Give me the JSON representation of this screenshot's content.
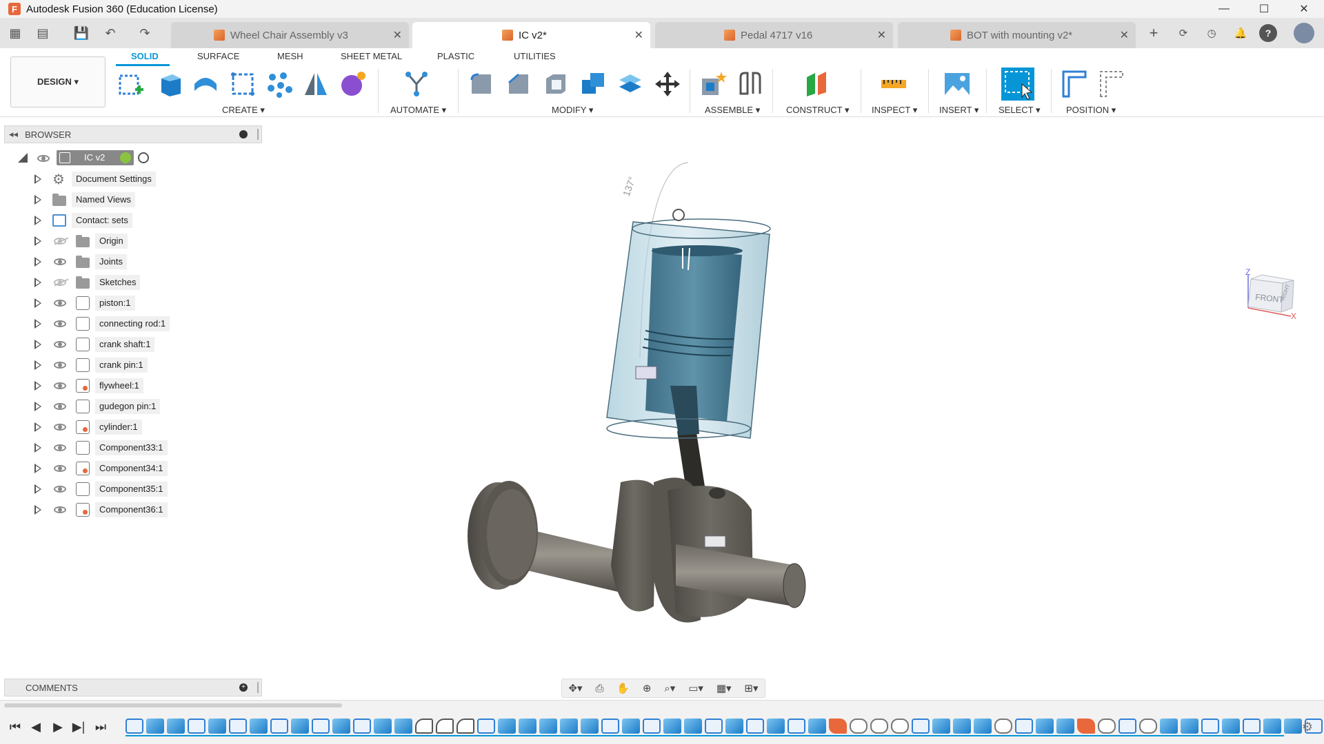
{
  "window": {
    "title": "Autodesk Fusion 360 (Education License)",
    "logo": "F"
  },
  "tabs": [
    {
      "label": "Wheel Chair Assembly v3",
      "active": false
    },
    {
      "label": "IC v2*",
      "active": true
    },
    {
      "label": "Pedal 4717 v16",
      "active": false
    },
    {
      "label": "BOT with mounting v2*",
      "active": false
    }
  ],
  "toolbar": {
    "workspace": "DESIGN ▾",
    "tabs": [
      "SOLID",
      "SURFACE",
      "MESH",
      "SHEET METAL",
      "PLASTIC",
      "UTILITIES"
    ],
    "groups": [
      "CREATE ▾",
      "AUTOMATE ▾",
      "MODIFY ▾",
      "ASSEMBLE ▾",
      "CONSTRUCT ▾",
      "INSPECT ▾",
      "INSERT ▾",
      "SELECT ▾",
      "POSITION ▾"
    ]
  },
  "browser": {
    "title": "BROWSER",
    "root": "IC v2",
    "items": [
      {
        "label": "Document Settings",
        "icon": "gear-icon",
        "visible": true
      },
      {
        "label": "Named Views",
        "icon": "folder-icon",
        "visible": true
      },
      {
        "label": "Contact: sets",
        "icon": "contact-sets-icon",
        "visible": true
      },
      {
        "label": "Origin",
        "icon": "folder-icon",
        "visible": false
      },
      {
        "label": "Joints",
        "icon": "folder-icon",
        "visible": true
      },
      {
        "label": "Sketches",
        "icon": "folder-icon",
        "visible": false
      },
      {
        "label": "piston:1",
        "icon": "component-icon",
        "visible": true
      },
      {
        "label": "connecting rod:1",
        "icon": "component-icon",
        "visible": true
      },
      {
        "label": "crank shaft:1",
        "icon": "component-icon",
        "visible": true
      },
      {
        "label": "crank pin:1",
        "icon": "component-icon",
        "visible": true
      },
      {
        "label": "flywheel:1",
        "icon": "linked-component-icon",
        "visible": true
      },
      {
        "label": "gudegon pin:1",
        "icon": "component-icon",
        "visible": true
      },
      {
        "label": "cylinder:1",
        "icon": "linked-component-icon",
        "visible": true
      },
      {
        "label": "Component33:1",
        "icon": "component-icon",
        "visible": true
      },
      {
        "label": "Component34:1",
        "icon": "linked-component-icon",
        "visible": true
      },
      {
        "label": "Component35:1",
        "icon": "component-icon",
        "visible": true
      },
      {
        "label": "Component36:1",
        "icon": "linked-component-icon",
        "visible": true
      }
    ]
  },
  "viewport": {
    "angle_label": "137°",
    "viewcube_front": "FRONT",
    "viewcube_right": "RIGHT",
    "axis_z": "Z",
    "axis_x": "X"
  },
  "comments": {
    "title": "COMMENTS"
  },
  "timeline": {
    "items": [
      "sk",
      "ex",
      "ex",
      "sk",
      "ex",
      "sk",
      "ex",
      "sk",
      "ex",
      "sk",
      "ex",
      "sk",
      "ex",
      "ex",
      "fl",
      "fl",
      "fl",
      "sk",
      "ex",
      "ex",
      "ex",
      "ex",
      "ex",
      "sk",
      "ex",
      "sk",
      "ex",
      "ex",
      "sk",
      "ex",
      "sk",
      "ex",
      "sk",
      "ex",
      "pn",
      "jt",
      "jt",
      "jt",
      "sk",
      "ex",
      "ex",
      "ex",
      "jt",
      "sk",
      "ex",
      "ex",
      "pn",
      "jt",
      "sk",
      "jt",
      "ex",
      "ex",
      "sk",
      "ex",
      "sk",
      "ex",
      "ex",
      "sk",
      "ex",
      "ex",
      "sk"
    ]
  },
  "colors": {
    "accent": "#0696d7",
    "brand": "#e8683b"
  }
}
